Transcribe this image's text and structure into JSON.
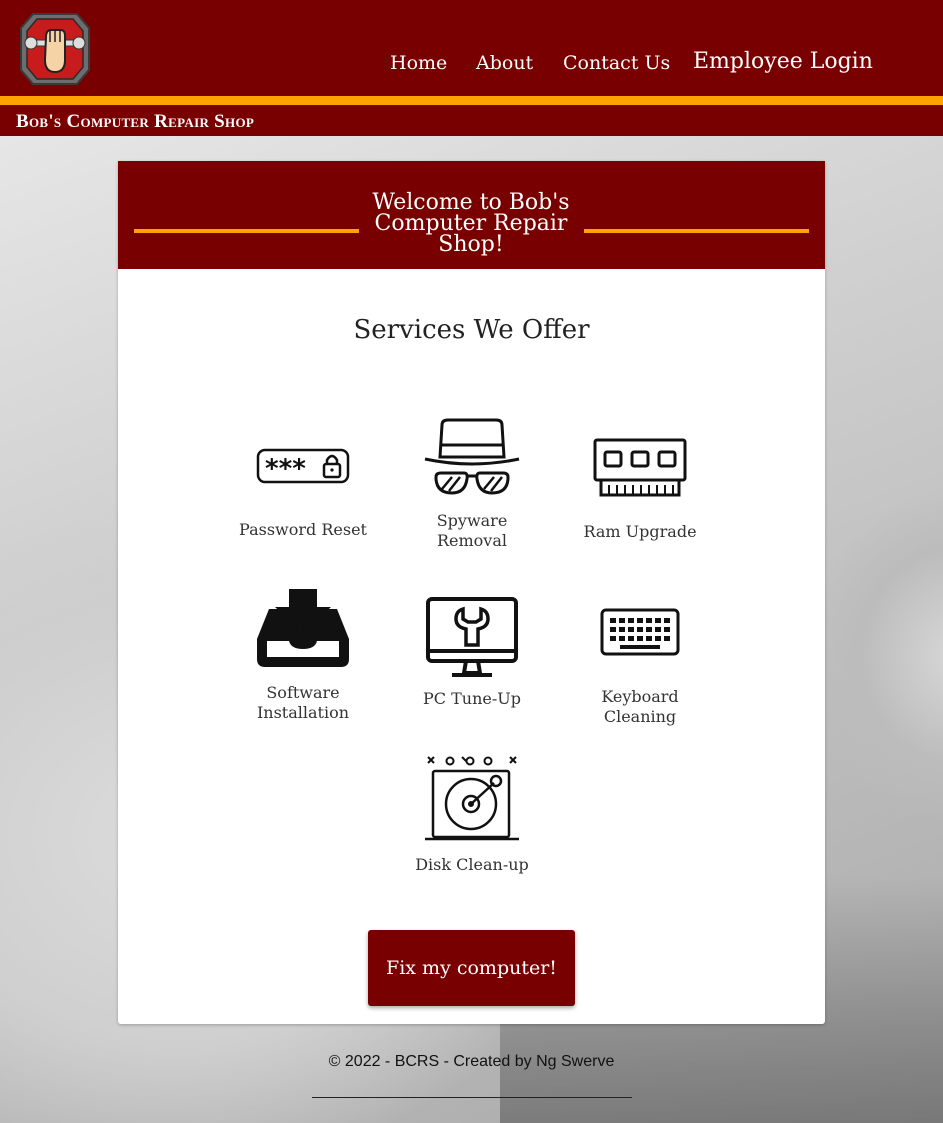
{
  "header": {
    "nav": [
      "Home",
      "About",
      "Contact Us",
      "Employee Login"
    ],
    "shop_name": "Bob's Computer Repair Shop"
  },
  "card": {
    "welcome_title": "Welcome to Bob's Computer Repair Shop!",
    "services_title": "Services We Offer",
    "services": [
      {
        "label": "Password Reset",
        "icon": "password-icon"
      },
      {
        "label": "Spyware Removal",
        "icon": "spy-icon"
      },
      {
        "label": "Ram Upgrade",
        "icon": "ram-icon"
      },
      {
        "label": "Software Installation",
        "icon": "download-tray-icon"
      },
      {
        "label": "PC Tune-Up",
        "icon": "monitor-wrench-icon"
      },
      {
        "label": "Keyboard Cleaning",
        "icon": "keyboard-icon"
      },
      {
        "label": "Disk Clean-up",
        "icon": "hard-disk-icon"
      }
    ],
    "cta_label": "Fix my computer!"
  },
  "footer": {
    "copyright": "© 2022 - BCRS - Created by Ng Swerve"
  },
  "colors": {
    "maroon": "#780000",
    "gold": "#ffa300",
    "white": "#ffffff"
  }
}
